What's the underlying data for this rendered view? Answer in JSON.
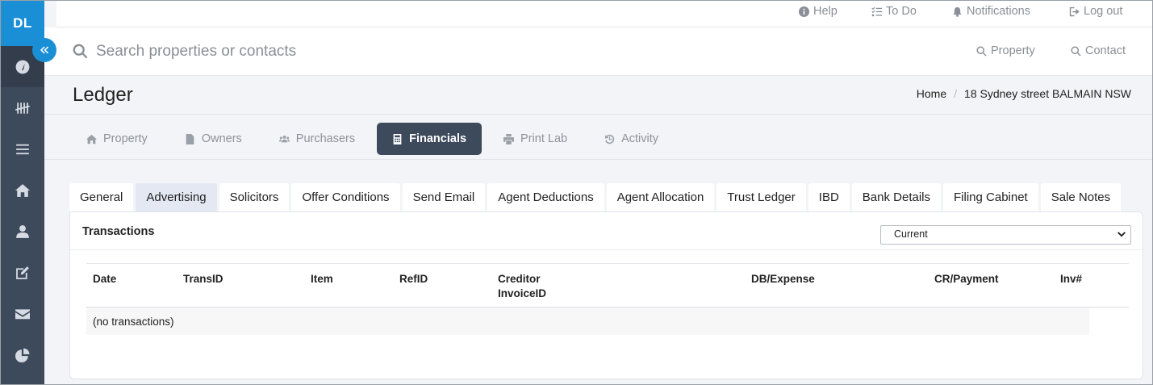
{
  "app": {
    "logo": "DL"
  },
  "sidebar": {
    "items": [
      {
        "icon": "dashboard-icon"
      },
      {
        "icon": "tally-icon"
      },
      {
        "icon": "list-icon"
      },
      {
        "icon": "home-icon"
      },
      {
        "icon": "user-icon"
      },
      {
        "icon": "edit-icon"
      },
      {
        "icon": "mail-icon"
      },
      {
        "icon": "pie-chart-icon"
      }
    ]
  },
  "topbar": {
    "help": "Help",
    "todo": "To Do",
    "notifications": "Notifications",
    "logout": "Log out"
  },
  "search": {
    "placeholder": "Search properties or contacts",
    "property_link": "Property",
    "contact_link": "Contact"
  },
  "page": {
    "title": "Ledger",
    "breadcrumb": [
      "Home",
      "18 Sydney street BALMAIN NSW"
    ]
  },
  "main_tabs": [
    {
      "label": "Property",
      "icon": "home-icon"
    },
    {
      "label": "Owners",
      "icon": "file-icon"
    },
    {
      "label": "Purchasers",
      "icon": "users-icon"
    },
    {
      "label": "Financials",
      "icon": "calculator-icon",
      "active": true
    },
    {
      "label": "Print Lab",
      "icon": "printer-icon"
    },
    {
      "label": "Activity",
      "icon": "history-icon"
    }
  ],
  "sub_tabs": [
    {
      "label": "General"
    },
    {
      "label": "Advertising",
      "active": true
    },
    {
      "label": "Solicitors"
    },
    {
      "label": "Offer Conditions"
    },
    {
      "label": "Send Email"
    },
    {
      "label": "Agent Deductions"
    },
    {
      "label": "Agent Allocation"
    },
    {
      "label": "Trust Ledger"
    },
    {
      "label": "IBD"
    },
    {
      "label": "Bank Details"
    },
    {
      "label": "Filing Cabinet"
    },
    {
      "label": "Sale Notes"
    }
  ],
  "panel": {
    "title": "Transactions",
    "filter_value": "Current",
    "columns": [
      "Date",
      "TransID",
      "Item",
      "RefID",
      "Creditor InvoiceID",
      "DB/Expense",
      "CR/Payment",
      "Inv#"
    ],
    "empty_message": "(no transactions)"
  },
  "colors": {
    "sidebar": "#3d4a5c",
    "accent": "#1b8fd6",
    "active_tab": "#3d4a5c",
    "active_subtab": "#e4e8f3"
  }
}
